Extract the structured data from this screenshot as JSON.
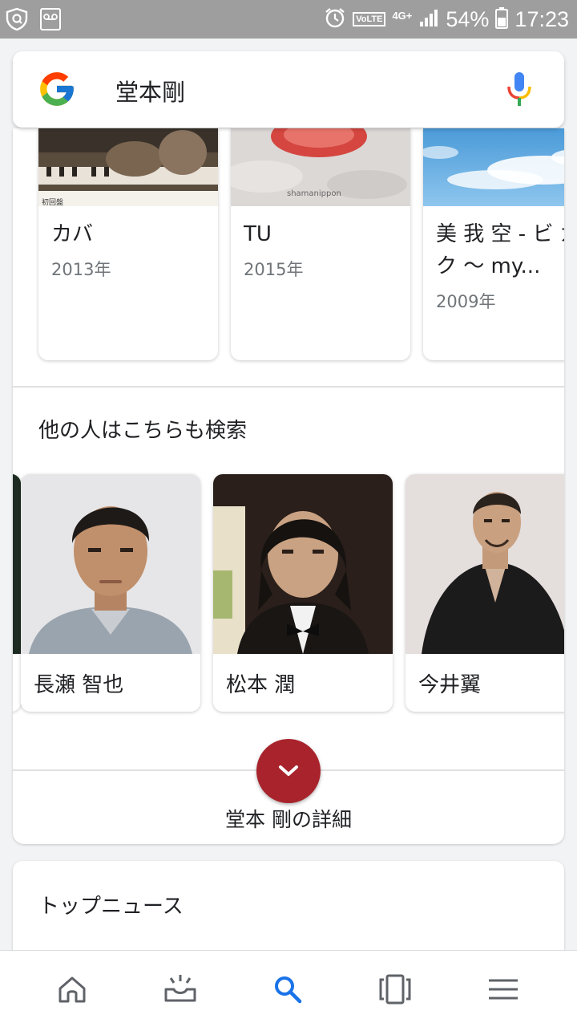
{
  "status_bar": {
    "battery": "54%",
    "time": "17:23",
    "volte": "VoLTE",
    "network": "4G+"
  },
  "search": {
    "query": "堂本剛"
  },
  "albums": [
    {
      "title": "カバ",
      "year": "2013年"
    },
    {
      "title": "TU",
      "year": "2015年"
    },
    {
      "title": "美 我 空 - ビ ガ ク ～ my...",
      "year": "2009年"
    }
  ],
  "thumb_text": {
    "album1_label": "初回盤",
    "album2_label": "shamanippon"
  },
  "related": {
    "title": "他の人はこちらも検索",
    "people": [
      {
        "name": "長瀬 智也"
      },
      {
        "name": "松本 潤"
      },
      {
        "name": "今井翼"
      }
    ]
  },
  "more_link": "堂本 剛の詳細",
  "news": {
    "title": "トップニュース"
  },
  "nav": {
    "items": [
      "home-icon",
      "updates-icon",
      "search-icon",
      "tabs-icon",
      "menu-icon"
    ],
    "active": "search-icon"
  },
  "colors": {
    "accent": "#1a73e8",
    "expand_button": "#a8232b",
    "status_bar": "#9e9e9e"
  }
}
